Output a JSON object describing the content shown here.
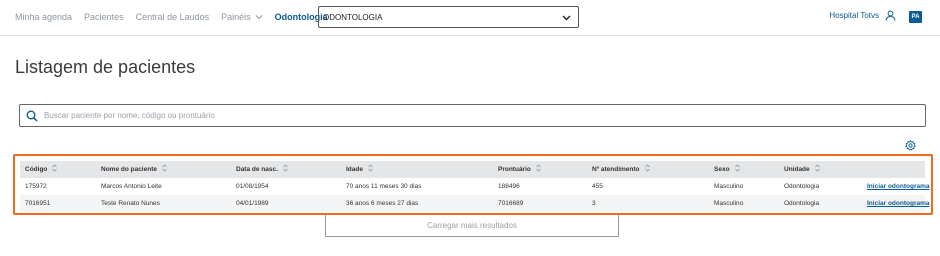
{
  "nav": {
    "items": [
      {
        "label": "Minha agenda"
      },
      {
        "label": "Pacientes"
      },
      {
        "label": "Central de Laudos"
      },
      {
        "label": "Painéis"
      },
      {
        "label": "Odontologia"
      }
    ],
    "module_select_value": "ODONTOLOGIA",
    "hospital": "Hospital Totvs",
    "avatar": "PA"
  },
  "page": {
    "title": "Listagem de pacientes"
  },
  "search": {
    "placeholder": "Buscar paciente por nome, código ou prontuário"
  },
  "table": {
    "headers": [
      "Código",
      "Nome do paciente",
      "Data de nasc.",
      "Idade",
      "Prontuário",
      "Nº atendimento",
      "Sexo",
      "Unidade"
    ],
    "rows": [
      [
        "175972",
        "Marcos Antonio Leite",
        "01/08/1954",
        "70 anos 11 meses 30 dias",
        "188496",
        "455",
        "Masculino",
        "Odontologia",
        "Iniciar odontograma"
      ],
      [
        "7016951",
        "Teste Renato Nunes",
        "04/01/1989",
        "36 anos 6 meses 27 dias",
        "7016689",
        "3",
        "Masculino",
        "Odontologia",
        "Iniciar odontograma"
      ]
    ]
  },
  "load_more": "Carregar mais resultados",
  "colors": {
    "accent": "#0b5c92",
    "highlight_border": "#f06a1e"
  }
}
